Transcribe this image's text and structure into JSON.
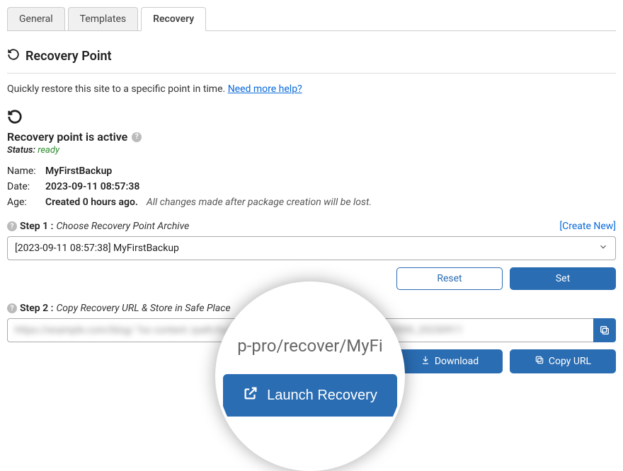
{
  "tabs": {
    "general": "General",
    "templates": "Templates",
    "recovery": "Recovery"
  },
  "section": {
    "title": "Recovery Point"
  },
  "intro": {
    "text": "Quickly restore this site to a specific point in time.",
    "help": "Need more help?"
  },
  "status": {
    "title": "Recovery point is active",
    "status_label": "Status:",
    "status_value": "ready"
  },
  "info": {
    "name_label": "Name:",
    "name_value": "MyFirstBackup",
    "date_label": "Date:",
    "date_value": "2023-09-11 08:57:38",
    "age_label": "Age:",
    "age_value": "Created 0 hours ago.",
    "age_note": "All changes made after package creation will be lost."
  },
  "step1": {
    "label": "Step 1 :",
    "desc": "Choose Recovery Point Archive",
    "create_new": "[Create New]",
    "selected": "[2023-09-11 08:57:38] MyFirstBackup"
  },
  "actions1": {
    "reset": "Reset",
    "set": "Set"
  },
  "step2": {
    "label": "Step 2 :",
    "desc": "Copy Recovery URL & Store in Safe Place",
    "url_blurred": "https://example.com/blog/ ?xx content /path/to/recovery/MyFirstBackup_abc1234567890_20230911"
  },
  "actions2": {
    "download": "Download",
    "copy_url": "Copy URL"
  },
  "highlight": {
    "url_fragment": "p-pro/recover/MyFi",
    "launch": "Launch Recovery"
  }
}
